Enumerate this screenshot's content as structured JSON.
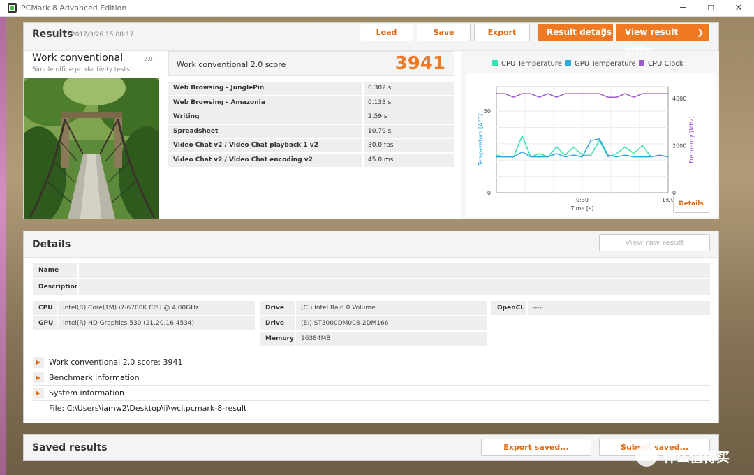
{
  "window": {
    "title": "PCMark 8 Advanced Edition",
    "min": "─",
    "max": "☐",
    "close": "✕"
  },
  "results": {
    "title": "Results",
    "date": "2017/3/26 15:08:17",
    "buttons": {
      "load": "Load",
      "save": "Save",
      "export": "Export",
      "result_details": "Result details",
      "view_online": "View result online"
    },
    "test_name": "Work conventional",
    "test_version": "2.0",
    "test_subtitle": "Simple office productivity tests",
    "score_label": "Work conventional 2.0 score",
    "score": "3941",
    "subtests": [
      {
        "name": "Web Browsing - JunglePin",
        "value": "0.302 s"
      },
      {
        "name": "Web Browsing - Amazonia",
        "value": "0.133 s"
      },
      {
        "name": "Writing",
        "value": "2.59 s"
      },
      {
        "name": "Spreadsheet",
        "value": "10.79 s"
      },
      {
        "name": "Video Chat v2 / Video Chat playback 1 v2",
        "value": "30.0 fps"
      },
      {
        "name": "Video Chat v2 / Video Chat encoding v2",
        "value": "45.0 ms"
      }
    ],
    "details_button": "Details"
  },
  "chart": {
    "legend": [
      "CPU Temperature",
      "GPU Temperature",
      "CPU Clock"
    ],
    "colors": {
      "cpu_temp": "#37e0b5",
      "gpu_temp": "#2ea8e0",
      "cpu_clock": "#9b59d0"
    },
    "left_ticks": [
      "0",
      "50"
    ],
    "right_ticks": [
      "0",
      "2000",
      "4000"
    ],
    "x_ticks": [
      "0:30",
      "1:00"
    ],
    "xlabel": "Time [s]",
    "ylabel_left": "Temperature [A°C]",
    "ylabel_right": "Frequency [MHz]"
  },
  "chart_data": {
    "type": "line",
    "xlabel": "Time [s]",
    "ylabel": "Temperature [A°C]",
    "y2label": "Frequency [MHz]",
    "xlim": [
      0,
      60
    ],
    "ylim": [
      0,
      65
    ],
    "y2lim": [
      0,
      4500
    ],
    "grid": true,
    "legend_position": "top",
    "series": [
      {
        "name": "CPU Temperature",
        "axis": "left",
        "color": "#37e0b5",
        "x": [
          0,
          3,
          6,
          9,
          12,
          15,
          18,
          21,
          24,
          27,
          30,
          33,
          36,
          39,
          42,
          45,
          48,
          51,
          54,
          57,
          60
        ],
        "y": [
          23,
          22,
          22,
          35,
          22,
          24,
          22,
          28,
          23,
          28,
          23,
          23,
          32,
          22,
          24,
          28,
          24,
          29,
          22,
          23,
          22
        ]
      },
      {
        "name": "GPU Temperature",
        "axis": "left",
        "color": "#2ea8e0",
        "x": [
          0,
          3,
          6,
          9,
          12,
          15,
          18,
          21,
          24,
          27,
          30,
          33,
          36,
          39,
          42,
          45,
          48,
          51,
          54,
          57,
          60
        ],
        "y": [
          22,
          22,
          22,
          25,
          22,
          22,
          22,
          24,
          22,
          23,
          22,
          32,
          33,
          23,
          22,
          23,
          22,
          22,
          22,
          23,
          22
        ]
      },
      {
        "name": "CPU Clock",
        "axis": "right",
        "color": "#9b59d0",
        "x": [
          0,
          3,
          6,
          9,
          12,
          15,
          18,
          21,
          24,
          27,
          30,
          33,
          36,
          39,
          42,
          45,
          48,
          51,
          54,
          57,
          60
        ],
        "y": [
          4200,
          4200,
          4050,
          4200,
          4200,
          4050,
          4200,
          4050,
          4200,
          4200,
          4200,
          4200,
          4200,
          4050,
          4050,
          4200,
          4050,
          4200,
          4200,
          4200,
          4200
        ]
      }
    ]
  },
  "details": {
    "title": "Details",
    "view_raw": "View raw result",
    "name_label": "Name",
    "description_label": "Description",
    "cpu_label": "CPU",
    "cpu_value": "Intel(R) Core(TM) i7-6700K CPU @ 4.00GHz",
    "gpu_label": "GPU",
    "gpu_value": "Intel(R) HD Graphics 530 (21.20.16.4534)",
    "drive_label": "Drive",
    "drive1": "(C:) Intel Raid 0 Volume",
    "drive2": "(E:) ST3000DM008-2DM166",
    "memory_label": "Memory",
    "memory_value": "16384MB",
    "opencl_label": "OpenCL",
    "opencl_value": "----",
    "expanders": [
      "Work conventional 2.0 score: 3941",
      "Benchmark information",
      "System information"
    ],
    "file": "File: C:\\Users\\iamw2\\Desktop\\ii\\wci.pcmark-8-result"
  },
  "saved": {
    "title": "Saved results",
    "export_saved": "Export saved...",
    "submit_saved": "Submit saved..."
  },
  "watermark": "什么值得买"
}
